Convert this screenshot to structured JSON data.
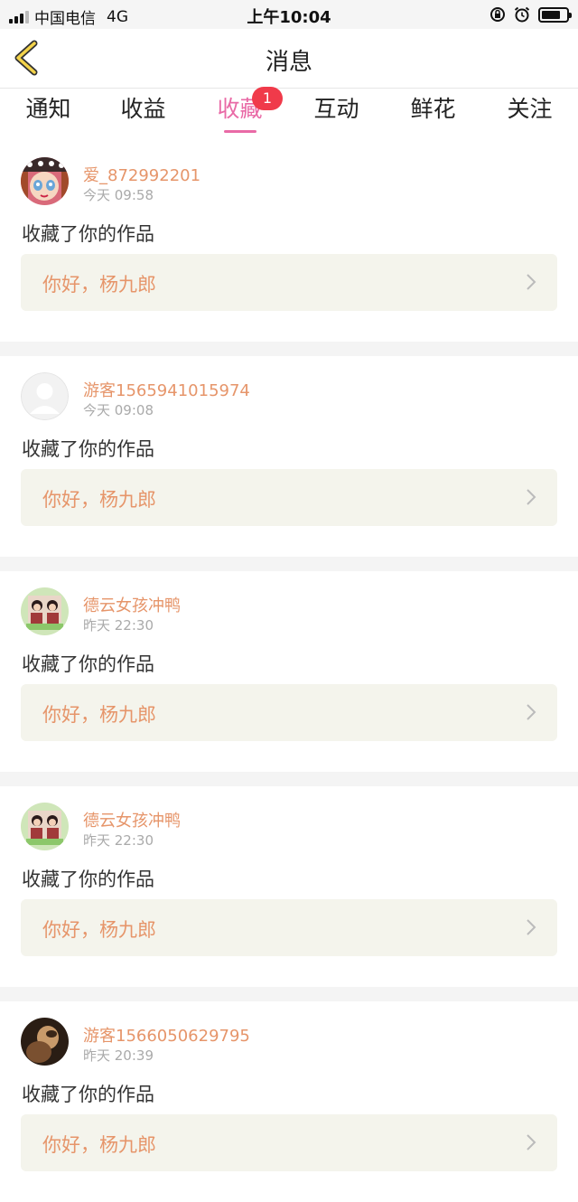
{
  "status_bar": {
    "carrier": "中国电信",
    "network": "4G",
    "time": "上午10:04",
    "battery_level": 0.75
  },
  "nav": {
    "title": "消息"
  },
  "tabs": [
    {
      "label": "通知"
    },
    {
      "label": "收益"
    },
    {
      "label": "收藏",
      "active": true,
      "badge": "1"
    },
    {
      "label": "互动"
    },
    {
      "label": "鲜花"
    },
    {
      "label": "关注"
    }
  ],
  "feed": [
    {
      "user": "爱_872992201",
      "time": "今天 09:58",
      "action": "收藏了你的作品",
      "work": "你好，杨九郎",
      "avatar": "cartoon-girl"
    },
    {
      "user": "游客1565941015974",
      "time": "今天 09:08",
      "action": "收藏了你的作品",
      "work": "你好，杨九郎",
      "avatar": "default"
    },
    {
      "user": "德云女孩冲鸭",
      "time": "昨天 22:30",
      "action": "收藏了你的作品",
      "work": "你好，杨九郎",
      "avatar": "photo-duo"
    },
    {
      "user": "德云女孩冲鸭",
      "time": "昨天 22:30",
      "action": "收藏了你的作品",
      "work": "你好，杨九郎",
      "avatar": "photo-duo"
    },
    {
      "user": "游客1566050629795",
      "time": "昨天 20:39",
      "action": "收藏了你的作品",
      "work": "你好，杨九郎",
      "avatar": "photo-dark"
    }
  ],
  "colors": {
    "accent": "#e96aa6",
    "username": "#e6956a",
    "badge": "#f03a4a"
  }
}
